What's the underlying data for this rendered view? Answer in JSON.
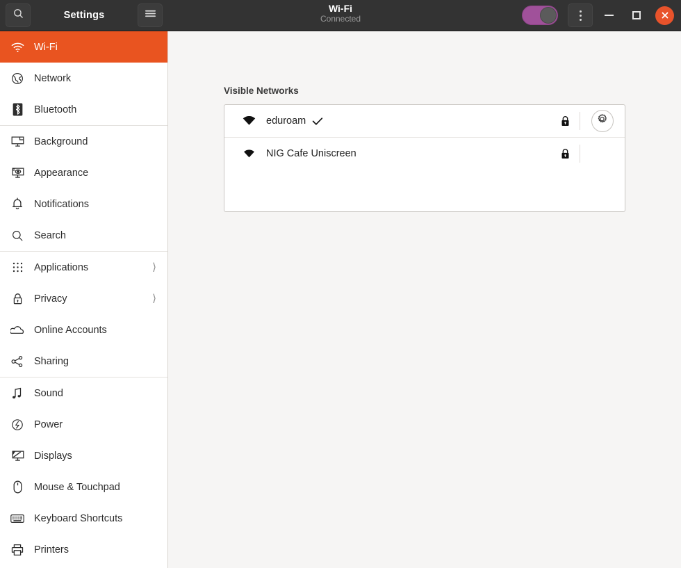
{
  "titlebar": {
    "search_icon": "search-icon",
    "app_title": "Settings",
    "menu_icon": "hamburger-menu-icon",
    "panel_title": "Wi-Fi",
    "panel_subtitle": "Connected",
    "wifi_toggle": {
      "name": "wifi-toggle",
      "state": "on",
      "color": "#a0519a"
    },
    "more_icon": "more-options-icon",
    "minimize_label": "Minimize",
    "maximize_label": "Maximize",
    "close_label": "Close",
    "close_color": "#e8532b"
  },
  "sidebar": {
    "accent_color": "#e95420",
    "items": [
      {
        "label": "Wi-Fi",
        "icon": "wifi-icon",
        "active": true,
        "chevron": false
      },
      {
        "label": "Network",
        "icon": "network-globe-icon",
        "active": false,
        "chevron": false
      },
      {
        "label": "Bluetooth",
        "icon": "bluetooth-icon",
        "active": false,
        "chevron": false
      },
      {
        "label": "Background",
        "icon": "background-icon",
        "active": false,
        "chevron": false
      },
      {
        "label": "Appearance",
        "icon": "appearance-icon",
        "active": false,
        "chevron": false
      },
      {
        "label": "Notifications",
        "icon": "bell-icon",
        "active": false,
        "chevron": false
      },
      {
        "label": "Search",
        "icon": "search-icon",
        "active": false,
        "chevron": false
      },
      {
        "label": "Applications",
        "icon": "apps-grid-icon",
        "active": false,
        "chevron": true
      },
      {
        "label": "Privacy",
        "icon": "lock-icon",
        "active": false,
        "chevron": true
      },
      {
        "label": "Online Accounts",
        "icon": "cloud-icon",
        "active": false,
        "chevron": false
      },
      {
        "label": "Sharing",
        "icon": "share-icon",
        "active": false,
        "chevron": false
      },
      {
        "label": "Sound",
        "icon": "sound-note-icon",
        "active": false,
        "chevron": false
      },
      {
        "label": "Power",
        "icon": "power-icon",
        "active": false,
        "chevron": false
      },
      {
        "label": "Displays",
        "icon": "display-icon",
        "active": false,
        "chevron": false
      },
      {
        "label": "Mouse & Touchpad",
        "icon": "mouse-icon",
        "active": false,
        "chevron": false
      },
      {
        "label": "Keyboard Shortcuts",
        "icon": "keyboard-icon",
        "active": false,
        "chevron": false
      },
      {
        "label": "Printers",
        "icon": "printer-icon",
        "active": false,
        "chevron": false
      }
    ],
    "separators_after": [
      2,
      6,
      10
    ]
  },
  "main": {
    "section_title": "Visible Networks",
    "networks": [
      {
        "name": "eduroam",
        "signal_icon": "wifi-signal-strong-icon",
        "connected": true,
        "check_icon": "check-icon",
        "secured": true,
        "lock_icon": "lock-icon",
        "settings_icon": "gear-icon",
        "has_settings_button": true
      },
      {
        "name": "NIG Cafe Uniscreen",
        "signal_icon": "wifi-signal-medium-icon",
        "connected": false,
        "check_icon": "",
        "secured": true,
        "lock_icon": "lock-icon",
        "settings_icon": "",
        "has_settings_button": false
      }
    ]
  }
}
